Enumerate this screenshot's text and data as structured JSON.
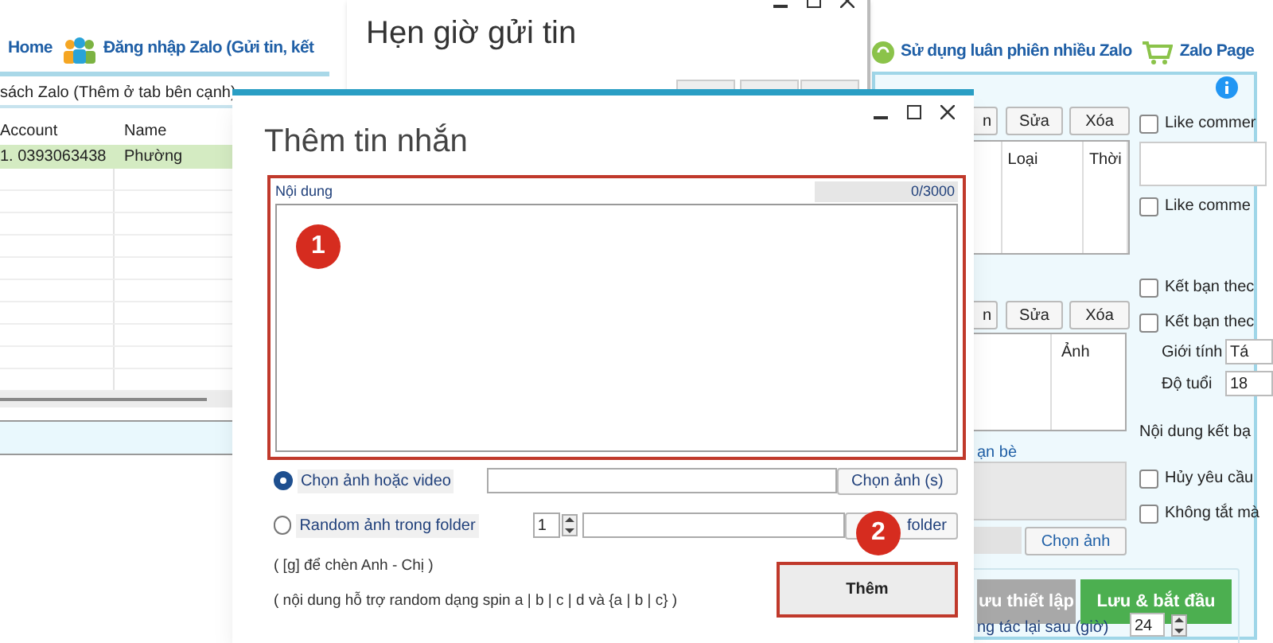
{
  "toolbar_left": [
    {
      "kind": "home",
      "label": "Home"
    },
    {
      "kind": "people",
      "label": "Đăng nhập Zalo (Gửi tin, kết"
    }
  ],
  "toolbar_right": [
    {
      "kind": "rotate",
      "label": "Sử dụng luân phiên nhiều Zalo"
    },
    {
      "kind": "cart",
      "label": "Zalo Page"
    }
  ],
  "account_list": {
    "title": "sách Zalo (Thêm ở tab bên cạnh)",
    "columns": [
      "Account",
      "Name"
    ],
    "rows": [
      {
        "cells": [
          "1. 0393063438",
          "Phường"
        ],
        "selected": true
      }
    ]
  },
  "right_panel": {
    "message_buttons": [
      "n",
      "Sửa",
      "Xóa"
    ],
    "message_columns": [
      "Loại",
      "Thời"
    ],
    "image_buttons": [
      "n",
      "Sửa",
      "Xóa"
    ],
    "image_columns": [
      "Ảnh"
    ],
    "like_options": [
      {
        "label": "Like commer",
        "checked": false
      },
      {
        "label": "Like comme",
        "checked": false
      }
    ],
    "friend_options": [
      {
        "label": "Kết bạn thec",
        "checked": false
      },
      {
        "label": "Kết bạn thec",
        "checked": false
      }
    ],
    "gender": {
      "label": "Giới tính",
      "value": "Tá"
    },
    "age": {
      "label": "Độ tuổi",
      "value": "18"
    },
    "friend_content_label": "Nội dung kết bạ",
    "other_options": [
      {
        "label": "Hủy yêu cầu",
        "checked": false
      },
      {
        "label": "Không tắt mà",
        "checked": false
      }
    ],
    "friends_label": "ạn bè",
    "choose_image_button": "Chọn ảnh",
    "save_button": "ưu thiết lập",
    "start_button": "Lưu & bắt đầu",
    "repeat_label": "ng tác lại sau (giờ)",
    "repeat_value": "24"
  },
  "schedule_window": {
    "title": "Hẹn giờ gửi tin"
  },
  "dialog": {
    "title": "Thêm tin nhắn",
    "content": {
      "label": "Nội dung",
      "counter": "0/3000",
      "highlighted": true
    },
    "media_options": [
      {
        "label": "Chọn ảnh hoặc video",
        "selected": true,
        "button": "Chọn ảnh (s)"
      },
      {
        "label": "Random ảnh trong folder",
        "selected": false,
        "count": "1",
        "button": "folder"
      }
    ],
    "notes": [
      "( [g] để chèn Anh - Chị )",
      "( nội dung hỗ trợ random dạng spin a | b | c | d và {a | b | c} )"
    ],
    "add_button": {
      "label": "Thêm",
      "highlighted": true
    }
  },
  "markers": [
    "1",
    "2"
  ]
}
